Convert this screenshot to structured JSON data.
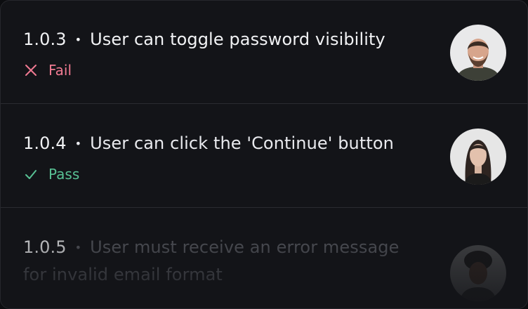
{
  "tests": [
    {
      "version": "1.0.3",
      "bullet": "•",
      "title": "User can toggle password visibility",
      "status": "Fail",
      "status_icon": "x-icon",
      "status_color": "#f07a92",
      "avatar": "avatar-man-beard"
    },
    {
      "version": "1.0.4",
      "bullet": "•",
      "title": "User can click the 'Continue' button",
      "status": "Pass",
      "status_icon": "check-icon",
      "status_color": "#58c194",
      "avatar": "avatar-woman-dark-hair"
    },
    {
      "version": "1.0.5",
      "bullet": "•",
      "title": "User must receive an error message for invalid email format",
      "avatar": "avatar-man-curly-hair"
    }
  ]
}
